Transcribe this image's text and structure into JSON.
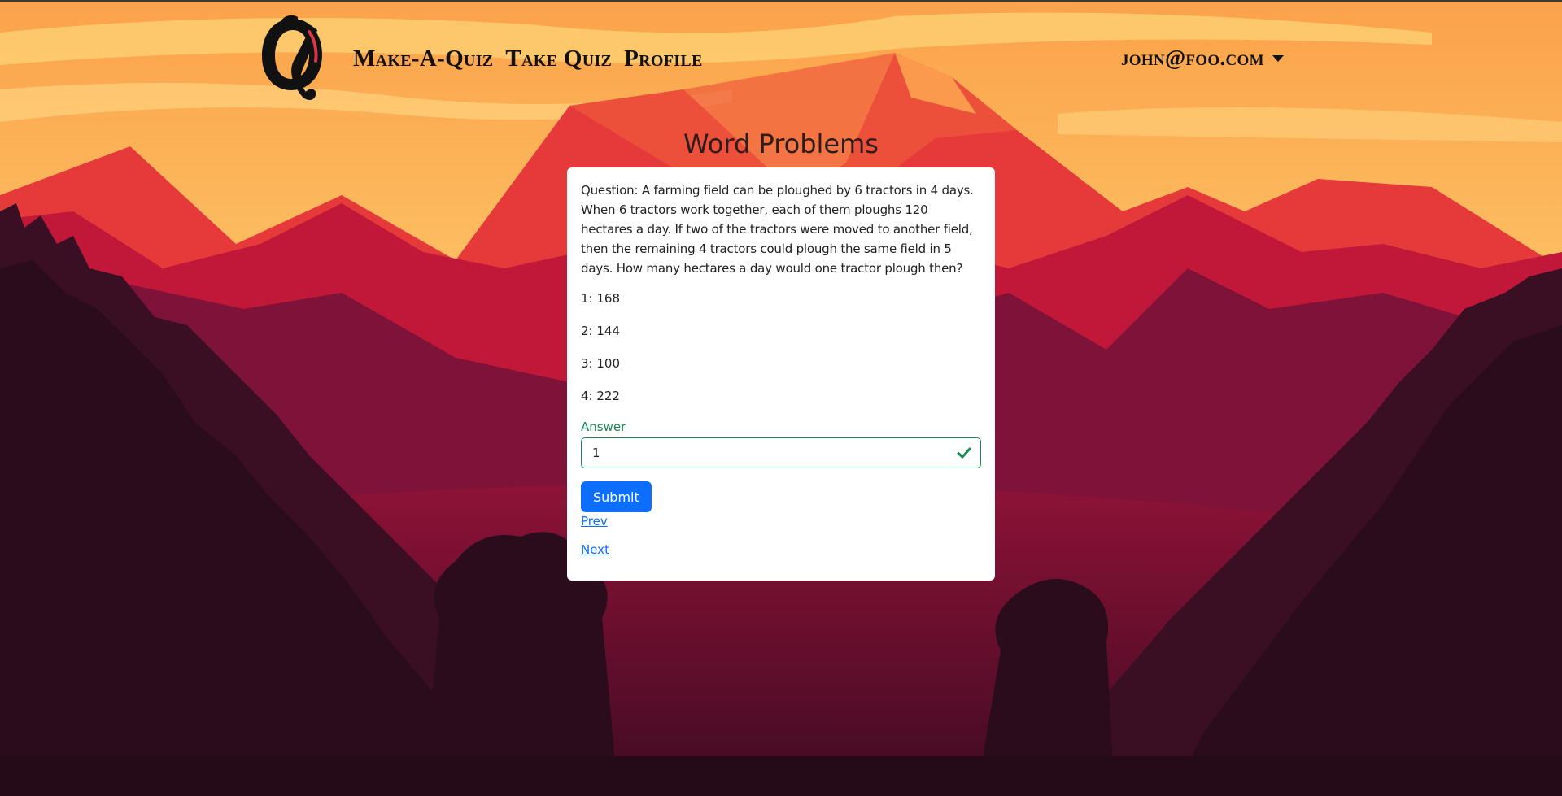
{
  "navbar": {
    "brand_logo": "quiz-logo-icon",
    "links": [
      "Make-A-Quiz",
      "Take Quiz",
      "Profile"
    ],
    "user_email": "john@foo.com",
    "dropdown_icon": "caret-down-icon"
  },
  "quiz": {
    "title": "Word Problems",
    "question": "Question: A farming field can be ploughed by 6 tractors in 4 days. When 6 tractors work together, each of them ploughs 120 hectares a day. If two of the tractors were moved to another field, then the remaining 4 tractors could plough the same field in 5 days. How many hectares a day would one tractor plough then?",
    "options": [
      "1: 168",
      "2: 144",
      "3: 100",
      "4: 222"
    ],
    "answer_label": "Answer",
    "answer_value": "1",
    "valid_icon": "checkmark-icon",
    "submit_label": "Submit",
    "prev_label": "Prev",
    "next_label": "Next"
  },
  "colors": {
    "sky": "#fcb454",
    "mountain_far": "#e43a32",
    "mountain_mid": "#b71c3a",
    "forest_dark": "#2a0d1d",
    "success": "#198754",
    "primary": "#0d6efd"
  }
}
